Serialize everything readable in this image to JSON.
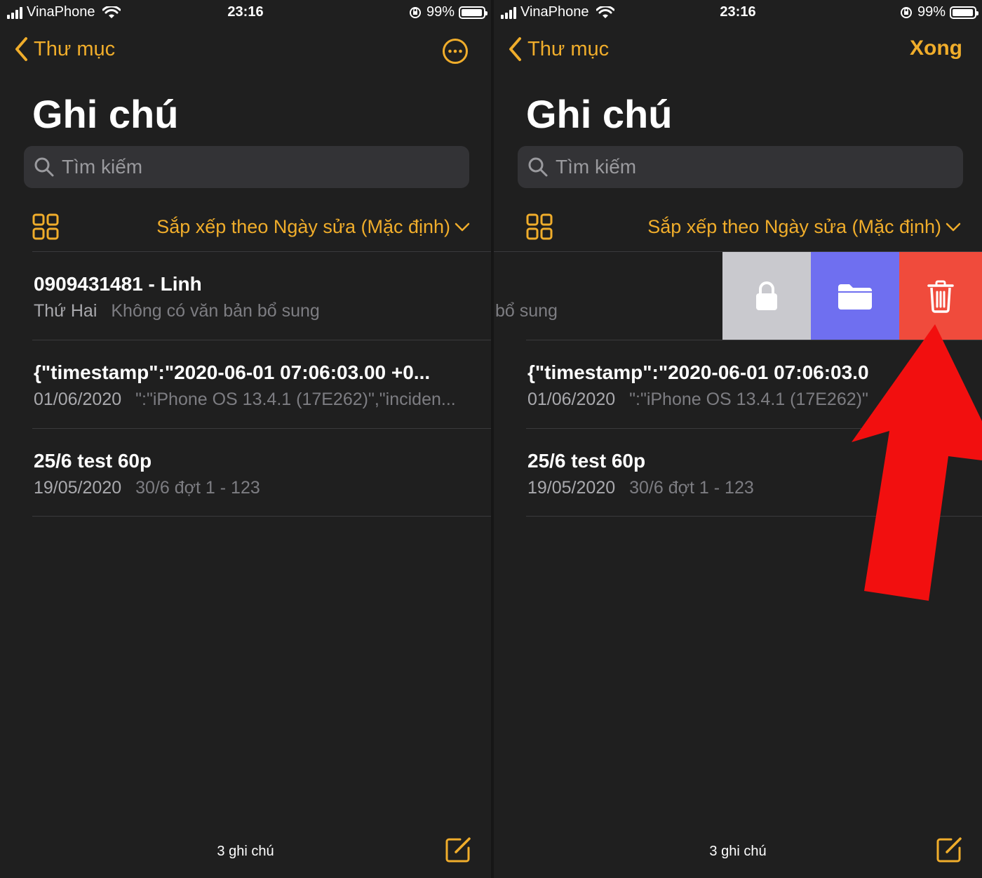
{
  "status": {
    "carrier": "VinaPhone",
    "time": "23:16",
    "battery": "99%"
  },
  "nav": {
    "back_label": "Thư mục",
    "done_label": "Xong"
  },
  "title": "Ghi chú",
  "search": {
    "placeholder": "Tìm kiếm"
  },
  "sort_label": "Sắp xếp theo Ngày sửa (Mặc định)",
  "left_notes": [
    {
      "title": "0909431481 - Linh",
      "date": "Thứ Hai",
      "preview": "Không có văn bản bổ sung"
    },
    {
      "title": "{\"timestamp\":\"2020-06-01 07:06:03.00 +0...",
      "date": "01/06/2020",
      "preview": "\":\"iPhone OS 13.4.1 (17E262)\",\"inciden..."
    },
    {
      "title": "25/6 test 60p",
      "date": "19/05/2020",
      "preview": "30/6 đợt 1 - 123"
    }
  ],
  "right_notes": [
    {
      "title": "",
      "date": "",
      "preview": "bổ sung"
    },
    {
      "title": "{\"timestamp\":\"2020-06-01 07:06:03.0",
      "date": "01/06/2020",
      "preview": "\":\"iPhone OS 13.4.1 (17E262)\""
    },
    {
      "title": "25/6 test 60p",
      "date": "19/05/2020",
      "preview": "30/6 đợt 1 - 123"
    }
  ],
  "footer": {
    "count": "3 ghi chú"
  },
  "colors": {
    "accent": "#f0ad2b",
    "lock": "#c9c9ce",
    "move": "#6f6ff0",
    "trash": "#f04b3c",
    "arrow": "#f20f0f"
  },
  "icons": [
    "signal-icon",
    "wifi-icon",
    "orientation-lock-icon",
    "battery-icon",
    "chevron-left-icon",
    "more-icon",
    "search-icon",
    "gallery-grid-icon",
    "chevron-down-icon",
    "lock-icon",
    "folder-icon",
    "trash-icon",
    "compose-icon",
    "arrow-annotation"
  ]
}
